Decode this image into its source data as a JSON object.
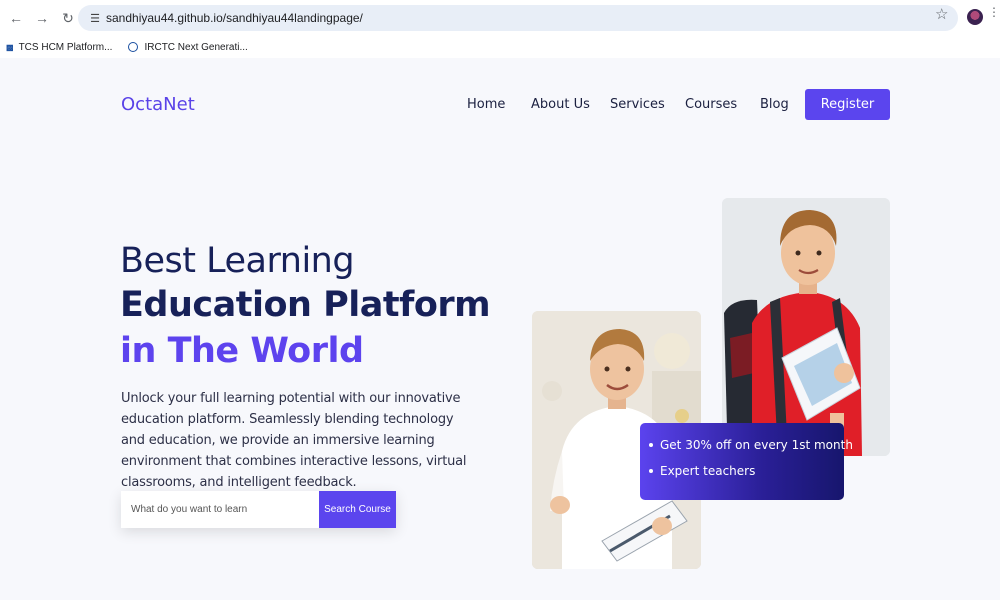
{
  "browser": {
    "url": "sandhiyau44.github.io/sandhiyau44landingpage/",
    "bookmarks": [
      {
        "label": "TCS HCM Platform..."
      },
      {
        "label": "IRCTC Next Generati..."
      }
    ]
  },
  "site": {
    "logo": "OctaNet",
    "nav": [
      {
        "label": "Home"
      },
      {
        "label": "About Us"
      },
      {
        "label": "Services"
      },
      {
        "label": "Courses"
      },
      {
        "label": "Blog"
      }
    ],
    "register_label": "Register",
    "colors": {
      "accent": "#5b45ee",
      "heading": "#172159"
    }
  },
  "hero": {
    "title_line1": "Best Learning",
    "title_line2": "Education Platform",
    "title_line3": "in The World",
    "description": "Unlock your full learning potential with our innovative education platform. Seamlessly blending technology and education, we provide an immersive learning environment that combines interactive lessons, virtual classrooms, and intelligent feedback.",
    "search_placeholder": "What do you want to learn",
    "search_button": "Search Course"
  },
  "promo": {
    "items": [
      "Get 30% off on every 1st month",
      "Expert teachers"
    ]
  }
}
